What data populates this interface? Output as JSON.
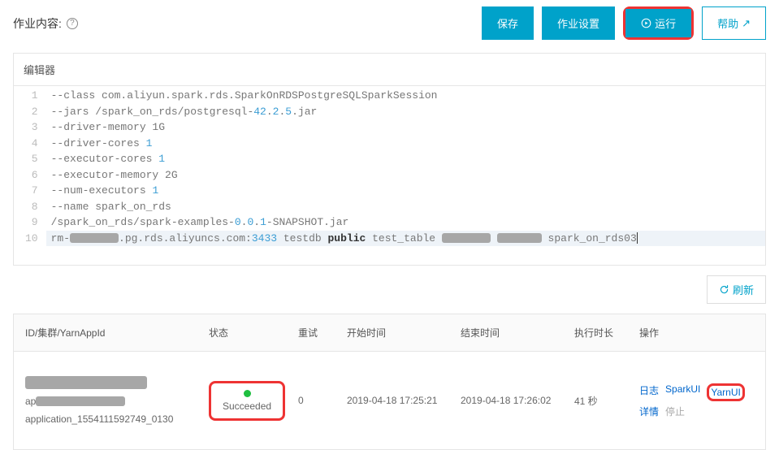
{
  "header": {
    "title": "作业内容:",
    "buttons": {
      "save": "保存",
      "jobSettings": "作业设置",
      "run": "运行",
      "help": "帮助"
    }
  },
  "editor": {
    "label": "编辑器",
    "lines": [
      {
        "raw": "--class com.aliyun.spark.rds.SparkOnRDSPostgreSQLSparkSession"
      },
      {
        "parts": [
          "--jars /spark_on_rds/postgresql-",
          {
            "n": "42"
          },
          ".",
          {
            "n": "2"
          },
          ".",
          {
            "n": "5"
          },
          ".jar"
        ]
      },
      {
        "raw": "--driver-memory 1G"
      },
      {
        "parts": [
          "--driver-cores ",
          {
            "n": "1"
          }
        ]
      },
      {
        "parts": [
          "--executor-cores ",
          {
            "n": "1"
          }
        ]
      },
      {
        "raw": "--executor-memory 2G"
      },
      {
        "parts": [
          "--num-executors ",
          {
            "n": "1"
          }
        ]
      },
      {
        "raw": "--name spark_on_rds"
      },
      {
        "parts": [
          "/spark_on_rds/spark-examples-",
          {
            "n": "0"
          },
          ".",
          {
            "n": "0"
          },
          ".",
          {
            "n": "1"
          },
          "-SNAPSHOT.jar"
        ]
      },
      {
        "parts": [
          "rm-",
          {
            "redact": 60
          },
          ".pg.rds.aliyuncs.com:",
          {
            "n": "3433"
          },
          " testdb ",
          {
            "kw": "public"
          },
          " test_table ",
          {
            "redact": 60
          },
          " ",
          {
            "redact": 55
          },
          " spark_on_rds03"
        ]
      }
    ]
  },
  "refresh": "刷新",
  "table": {
    "headers": {
      "id": "ID/集群/YarnAppId",
      "status": "状态",
      "retry": "重试",
      "start": "开始时间",
      "end": "结束时间",
      "dur": "执行时长",
      "ops": "操作"
    },
    "row": {
      "id_prefix": "ap",
      "app_id": "application_1554111592749_0130",
      "status": "Succeeded",
      "retry": "0",
      "start": "2019-04-18 17:25:21",
      "end": "2019-04-18 17:26:02",
      "dur": "41 秒",
      "ops": {
        "log": "日志",
        "sparkui": "SparkUI",
        "yarnui": "YarnUI",
        "detail": "详情",
        "stop": "停止"
      }
    }
  }
}
